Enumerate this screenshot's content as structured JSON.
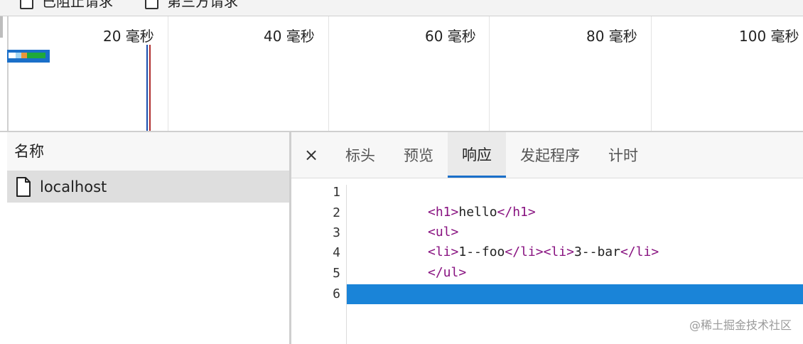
{
  "filters": {
    "blocked_requests_label": "已阻止请求",
    "third_party_label": "第三方请求"
  },
  "timeline": {
    "ticks": [
      "20  毫秒",
      "40  毫秒",
      "60  毫秒",
      "80  毫秒",
      "100  毫秒"
    ]
  },
  "requests": {
    "header": "名称",
    "items": [
      {
        "name": "localhost",
        "icon": "document-icon"
      }
    ]
  },
  "detail": {
    "close_icon": "×",
    "tabs": [
      {
        "label": "标头",
        "active": false
      },
      {
        "label": "预览",
        "active": false
      },
      {
        "label": "响应",
        "active": true
      },
      {
        "label": "发起程序",
        "active": false
      },
      {
        "label": "计时",
        "active": false
      }
    ]
  },
  "response": {
    "line_numbers": [
      "1",
      "2",
      "3",
      "4",
      "5",
      "6"
    ],
    "lines": [
      [],
      [
        {
          "t": "<h1>",
          "tag": true
        },
        {
          "t": "hello",
          "tag": false
        },
        {
          "t": "</h1>",
          "tag": true
        }
      ],
      [
        {
          "t": "<ul>",
          "tag": true
        }
      ],
      [
        {
          "t": "<li>",
          "tag": true
        },
        {
          "t": "1--foo",
          "tag": false
        },
        {
          "t": "</li>",
          "tag": true
        },
        {
          "t": "<li>",
          "tag": true
        },
        {
          "t": "3--bar",
          "tag": false
        },
        {
          "t": "</li>",
          "tag": true
        }
      ],
      [
        {
          "t": "</ul>",
          "tag": true
        }
      ],
      []
    ],
    "highlighted_line": 6
  },
  "watermark": "@稀土掘金技术社区",
  "colors": {
    "accent": "#1a6fc9",
    "tag": "#881280",
    "highlight": "#1a84d8"
  }
}
